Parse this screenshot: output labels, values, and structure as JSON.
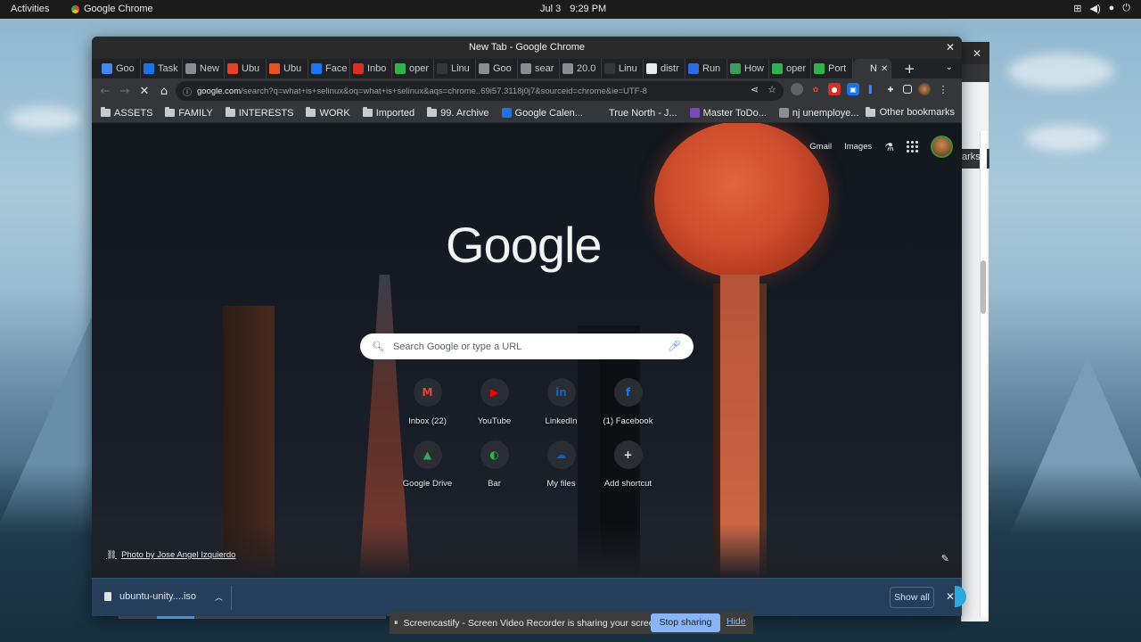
{
  "topbar": {
    "activities": "Activities",
    "app_name": "Google Chrome",
    "date": "Jul 3",
    "time": "9:29 PM"
  },
  "window": {
    "title": "New Tab - Google Chrome"
  },
  "tabs": [
    {
      "label": "Goo",
      "color": "#4285f4"
    },
    {
      "label": "Task",
      "color": "#1a73e8"
    },
    {
      "label": "New",
      "color": "#8a8d91"
    },
    {
      "label": "Ubu",
      "color": "#e2432a"
    },
    {
      "label": "Ubu",
      "color": "#e95420"
    },
    {
      "label": "Face",
      "color": "#1877f2"
    },
    {
      "label": "Inbo",
      "color": "#d93025"
    },
    {
      "label": "oper",
      "color": "#2fb34a"
    },
    {
      "label": "Linu",
      "color": "#35363a"
    },
    {
      "label": "Goo",
      "color": "#8a8d91"
    },
    {
      "label": "sear",
      "color": "#8a8d91"
    },
    {
      "label": "20.0",
      "color": "#8a8d91"
    },
    {
      "label": "Linu",
      "color": "#35363a"
    },
    {
      "label": "distr",
      "color": "#e8eaed"
    },
    {
      "label": "Run",
      "color": "#2d6be4"
    },
    {
      "label": "How",
      "color": "#3a9b5b"
    },
    {
      "label": "oper",
      "color": "#2fb34a"
    },
    {
      "label": "Port",
      "color": "#2fb34a"
    },
    {
      "label": "N",
      "color": "#35363a",
      "active": true
    }
  ],
  "toolbar": {
    "url_host": "google.com",
    "url_rest": "/search?q=what+is+selinux&oq=what+is+selinux&aqs=chrome..69i57.3118j0j7&sourceid=chrome&ie=UTF-8"
  },
  "bookmarks": [
    {
      "label": "ASSETS",
      "type": "folder"
    },
    {
      "label": "FAMILY",
      "type": "folder"
    },
    {
      "label": "INTERESTS",
      "type": "folder"
    },
    {
      "label": "WORK",
      "type": "folder"
    },
    {
      "label": "Imported",
      "type": "folder"
    },
    {
      "label": "99. Archive",
      "type": "folder"
    },
    {
      "label": "Google Calen...",
      "type": "link",
      "color": "#1a73e8"
    },
    {
      "label": "True North - J...",
      "type": "link",
      "color": "#35363a"
    },
    {
      "label": "Master ToDo...",
      "type": "link",
      "color": "#7b4ab8"
    },
    {
      "label": "nj unemploye...",
      "type": "link",
      "color": "#8a8d91"
    }
  ],
  "other_bookmarks": "Other bookmarks",
  "ntp": {
    "gmail": "Gmail",
    "images": "Images",
    "logo": "Google",
    "search_placeholder": "Search Google or type a URL",
    "shortcuts": [
      {
        "label": "Inbox (22)",
        "glyph": "M",
        "color": "#ea4335"
      },
      {
        "label": "YouTube",
        "glyph": "▶",
        "color": "#ff0000"
      },
      {
        "label": "LinkedIn",
        "glyph": "in",
        "color": "#0a66c2"
      },
      {
        "label": "(1) Facebook",
        "glyph": "f",
        "color": "#1877f2"
      },
      {
        "label": "Google Drive",
        "glyph": "▲",
        "color": "#34a853"
      },
      {
        "label": "Bar",
        "glyph": "◐",
        "color": "#2fb34a"
      },
      {
        "label": "My files",
        "glyph": "☁",
        "color": "#0364b8"
      },
      {
        "label": "Add shortcut",
        "glyph": "+",
        "color": "#e8eaed"
      }
    ],
    "photo_credit": "Photo by Jose Angel Izquierdo"
  },
  "download_shelf": {
    "file_name": "ubuntu-unity....iso",
    "show_all": "Show all"
  },
  "screencastify": {
    "message": "Screencastify - Screen Video Recorder is sharing your screen.",
    "stop": "Stop sharing",
    "hide": "Hide"
  },
  "background_window": {
    "bookmarks_fragment": "arks"
  }
}
